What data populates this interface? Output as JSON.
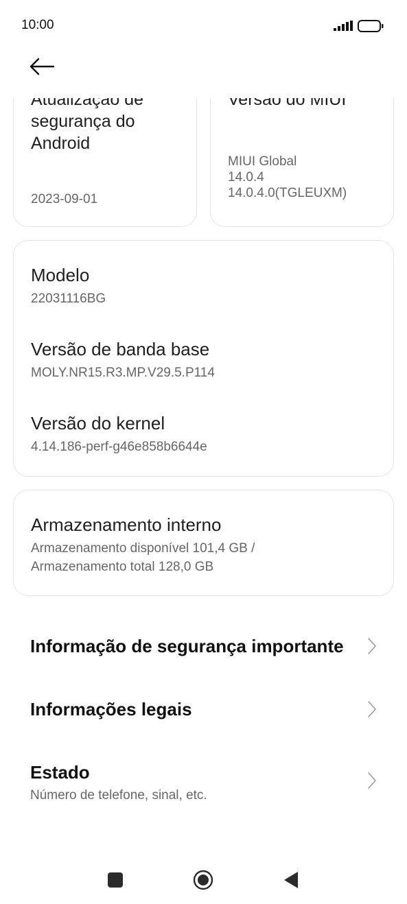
{
  "status_bar": {
    "time": "10:00"
  },
  "cards_top": [
    {
      "title": "Atualização de segurança do Android",
      "value": "2023-09-01"
    },
    {
      "title": "Versão do MIUI",
      "value": "MIUI Global\n14.0.4\n14.0.4.0(TGLEUXM)"
    }
  ],
  "device": {
    "model_label": "Modelo",
    "model_value": "22031116BG",
    "baseband_label": "Versão de banda base",
    "baseband_value": "MOLY.NR15.R3.MP.V29.5.P114",
    "kernel_label": "Versão do kernel",
    "kernel_value": "4.14.186-perf-g46e858b6644e"
  },
  "storage": {
    "label": "Armazenamento interno",
    "value": "Armazenamento disponível  101,4 GB /\nArmazenamento total  128,0 GB"
  },
  "menu": {
    "safety": "Informação de segurança importante",
    "legal": "Informações legais",
    "status_title": "Estado",
    "status_subtitle": "Número de telefone, sinal, etc."
  },
  "icons": [
    "signal-icon",
    "battery-icon",
    "back-arrow-icon",
    "chevron-right-icon",
    "recents-icon",
    "home-icon",
    "back-icon"
  ]
}
